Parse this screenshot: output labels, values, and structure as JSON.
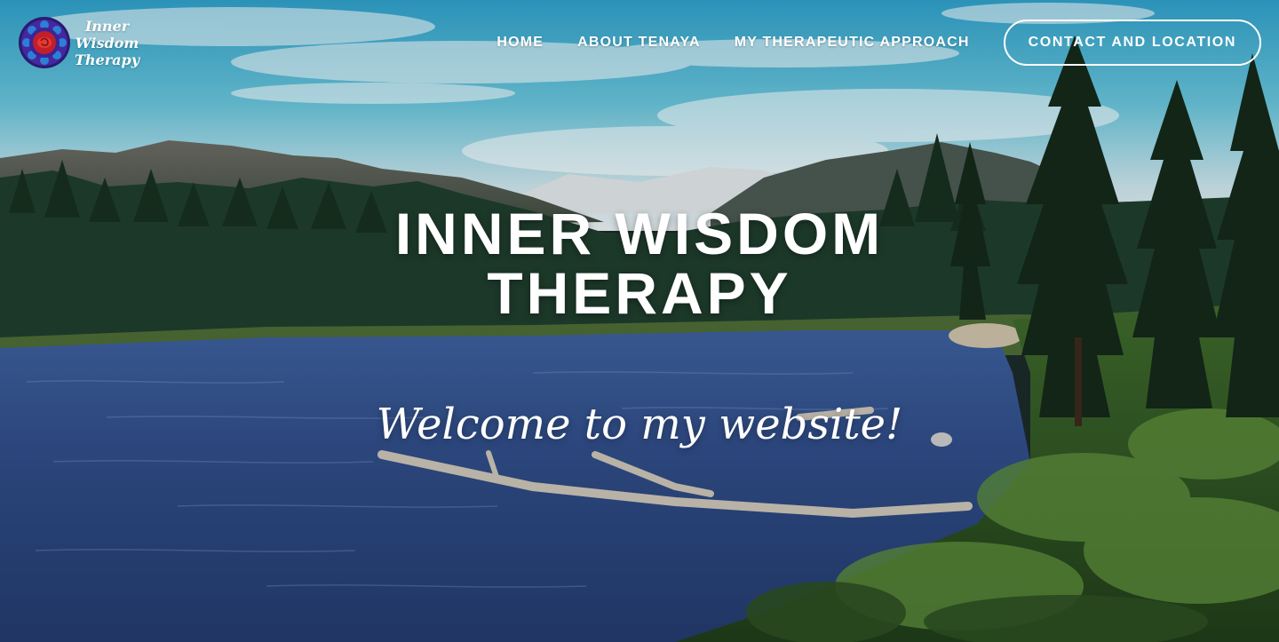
{
  "site": {
    "logo_text": [
      "Inner",
      "Wisdom",
      "Therapy"
    ]
  },
  "nav": {
    "items": [
      "HOME",
      "ABOUT TENAYA",
      "MY THERAPEUTIC APPROACH"
    ],
    "cta": "CONTACT AND LOCATION"
  },
  "hero": {
    "title_lines": [
      "INNER WISDOM",
      "THERAPY"
    ],
    "subtitle": "Welcome to my website!"
  },
  "colors": {
    "text": "#ffffff",
    "sky": "#4fb6d4",
    "lake": "#2b4c86",
    "forest": "#1d3a2c",
    "logo_outer": "#3b1f8e",
    "logo_inner": "#d2242a"
  },
  "icons": {
    "logo_mark": "mandala-rose-icon"
  }
}
